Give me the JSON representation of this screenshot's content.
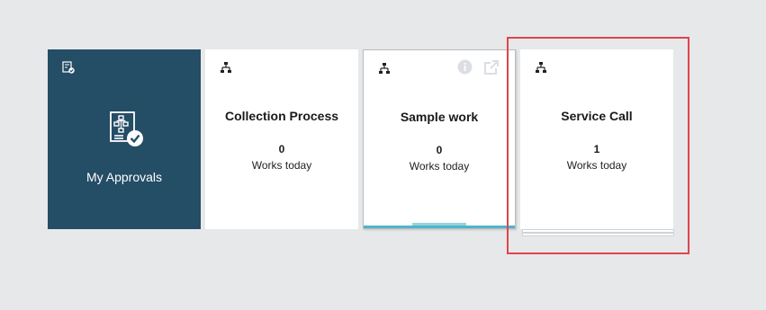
{
  "tiles": {
    "approvals": {
      "label": "My Approvals",
      "corner_icon": "approval-small-icon",
      "main_icon": "approval-checklist-icon",
      "background": "#244d66"
    },
    "collection": {
      "title": "Collection Process",
      "count": "0",
      "sub": "Works today",
      "icon": "workflow-hierarchy-icon"
    },
    "sample": {
      "title": "Sample work",
      "count": "0",
      "sub": "Works today",
      "icon": "workflow-hierarchy-icon",
      "actions": [
        "info-icon",
        "popout-icon"
      ],
      "accent": "#4fb5c9"
    },
    "service": {
      "title": "Service Call",
      "count": "1",
      "sub": "Works today",
      "icon": "workflow-hierarchy-icon",
      "highlight_color": "#e0454b"
    }
  }
}
